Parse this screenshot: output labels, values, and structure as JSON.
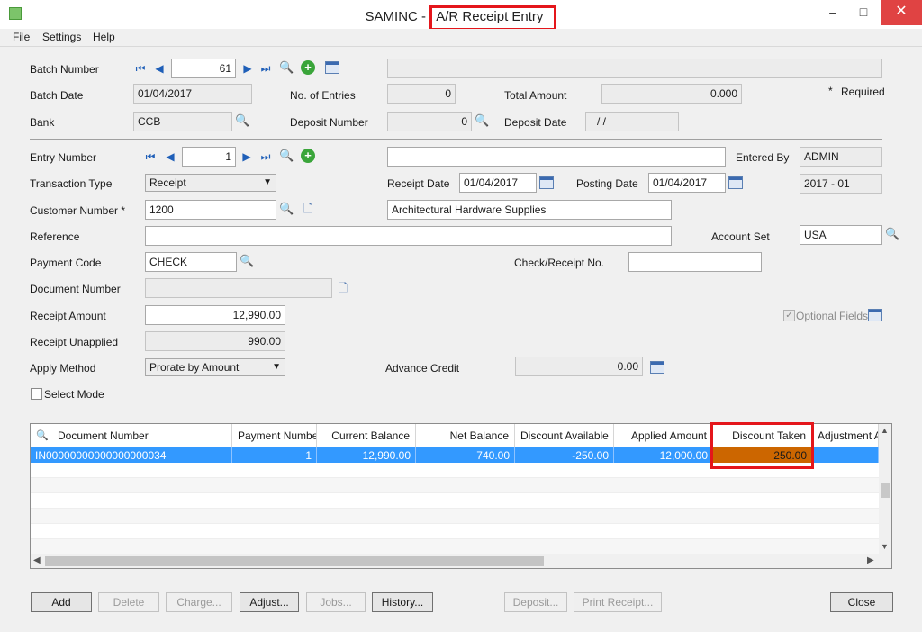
{
  "window": {
    "title_prefix": "SAMINC - ",
    "title_highlight": "A/R Receipt Entry",
    "minimize": "–",
    "maximize": "□",
    "close": "✕"
  },
  "menu": [
    "File",
    "Settings",
    "Help"
  ],
  "batch": {
    "batch_number_label": "Batch Number",
    "batch_number": "61",
    "batch_date_label": "Batch Date",
    "batch_date": "01/04/2017",
    "bank_label": "Bank",
    "bank": "CCB",
    "entries_label": "No. of Entries",
    "entries": "0",
    "deposit_label": "Deposit Number",
    "deposit": "0",
    "total_label": "Total Amount",
    "total": "0.000",
    "deposit_date_label": "Deposit Date",
    "deposit_date": "/  /",
    "required": "Required",
    "required_mark": "*"
  },
  "entry": {
    "entry_number_label": "Entry Number",
    "entry_number": "1",
    "entered_by_label": "Entered By",
    "entered_by": "ADMIN",
    "type_label": "Transaction Type",
    "type": "Receipt",
    "receipt_date_label": "Receipt Date",
    "receipt_date": "01/04/2017",
    "posting_date_label": "Posting Date",
    "posting_date": "01/04/2017",
    "period": "2017 - 01",
    "customer_label": "Customer Number *",
    "customer": "1200",
    "customer_name": "Architectural Hardware Supplies",
    "reference_label": "Reference",
    "account_set_label": "Account Set",
    "account_set": "USA",
    "payment_code_label": "Payment Code",
    "payment_code": "CHECK",
    "check_label": "Check/Receipt No.",
    "doc_number_label": "Document Number",
    "receipt_amount_label": "Receipt Amount",
    "receipt_amount": "12,990.00",
    "optional_fields": "Optional Fields",
    "unapplied_label": "Receipt Unapplied",
    "unapplied": "990.00",
    "apply_method_label": "Apply Method",
    "apply_method": "Prorate by Amount",
    "advance_credit_label": "Advance Credit",
    "advance_credit": "0.00",
    "select_mode": "Select Mode"
  },
  "grid": {
    "columns": [
      "Document Number",
      "Payment Number",
      "Current Balance",
      "Net Balance",
      "Discount Available",
      "Applied Amount",
      "Discount Taken",
      "Adjustment A"
    ],
    "row": [
      "IN00000000000000000034",
      "1",
      "12,990.00",
      "740.00",
      "-250.00",
      "12,000.00",
      "250.00",
      ""
    ],
    "highlight_color": "#cc6600"
  },
  "buttons": {
    "add": "Add",
    "delete": "Delete",
    "charge": "Charge...",
    "adjust": "Adjust...",
    "jobs": "Jobs...",
    "history": "History...",
    "deposit": "Deposit...",
    "print_receipt": "Print Receipt...",
    "close": "Close"
  }
}
